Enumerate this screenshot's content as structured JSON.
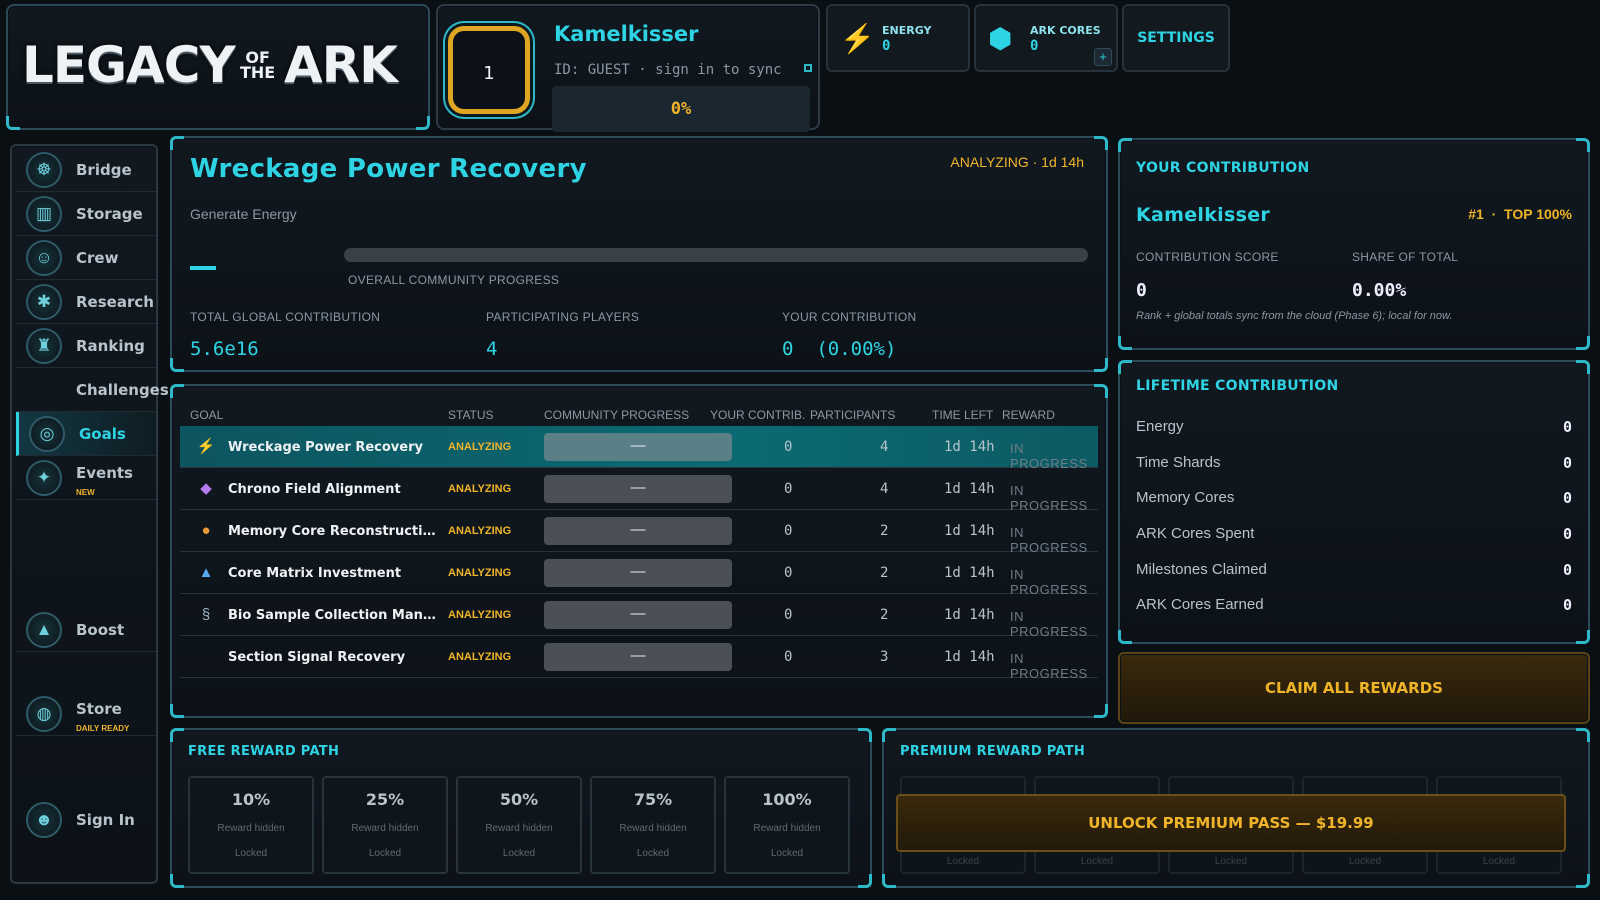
{
  "header": {
    "logo_main": "LEGACY",
    "logo_of": "OF",
    "logo_the": "THE",
    "logo_end": "ARK",
    "level": "1",
    "player_name": "Kamelkisser",
    "player_id": "ID: GUEST · sign in to sync",
    "progress_text": "0%",
    "energy_label": "ENERGY",
    "energy_value": "0",
    "cores_label": "ARK CORES",
    "cores_value": "0",
    "cores_add": "+",
    "settings_label": "SETTINGS"
  },
  "sidebar": {
    "items": [
      {
        "label": "Bridge",
        "icon": "helm-icon"
      },
      {
        "label": "Storage",
        "icon": "crate-icon"
      },
      {
        "label": "Crew",
        "icon": "crew-icon"
      },
      {
        "label": "Research",
        "icon": "atom-icon"
      },
      {
        "label": "Ranking",
        "icon": "podium-icon"
      },
      {
        "label": "Challenges",
        "icon": ""
      },
      {
        "label": "Goals",
        "icon": "target-icon",
        "active": true
      },
      {
        "label": "Events",
        "badge": "NEW",
        "icon": "compass-icon"
      },
      {
        "label": "Boost",
        "icon": "rocket-icon"
      },
      {
        "label": "Store",
        "badge": "DAILY READY",
        "icon": "bag-icon"
      },
      {
        "label": "Sign In",
        "icon": "user-icon"
      }
    ]
  },
  "goal": {
    "title": "Wreckage Power Recovery",
    "subtitle": "Generate Energy",
    "status": "ANALYZING · 1d 14h",
    "progress_label": "OVERALL COMMUNITY PROGRESS",
    "stats": [
      {
        "label": "TOTAL GLOBAL CONTRIBUTION",
        "value": "5.6e16"
      },
      {
        "label": "PARTICIPATING PLAYERS",
        "value": "4"
      },
      {
        "label": "YOUR CONTRIBUTION",
        "value": "0  (0.00%)"
      }
    ]
  },
  "table": {
    "headers": [
      "GOAL",
      "STATUS",
      "COMMUNITY PROGRESS",
      "YOUR CONTRIB.",
      "PARTICIPANTS",
      "TIME LEFT",
      "REWARD"
    ],
    "rows": [
      {
        "name": "Wreckage Power Recovery",
        "status": "ANALYZING",
        "progress": "—",
        "contrib": "0",
        "participants": "4",
        "time": "1d 14h",
        "reward": "IN PROGRESS",
        "icon": "lightning-icon"
      },
      {
        "name": "Chrono Field Alignment",
        "status": "ANALYZING",
        "progress": "—",
        "contrib": "0",
        "participants": "4",
        "time": "1d 14h",
        "reward": "IN PROGRESS",
        "icon": "crystal-icon"
      },
      {
        "name": "Memory Core Reconstruction",
        "status": "ANALYZING",
        "progress": "—",
        "contrib": "0",
        "participants": "2",
        "time": "1d 14h",
        "reward": "IN PROGRESS",
        "icon": "orb-icon"
      },
      {
        "name": "Core Matrix Investment",
        "status": "ANALYZING",
        "progress": "—",
        "contrib": "0",
        "participants": "2",
        "time": "1d 14h",
        "reward": "IN PROGRESS",
        "icon": "matrix-icon"
      },
      {
        "name": "Bio Sample Collection Mand...",
        "status": "ANALYZING",
        "progress": "—",
        "contrib": "0",
        "participants": "2",
        "time": "1d 14h",
        "reward": "IN PROGRESS",
        "icon": "dna-icon"
      },
      {
        "name": "Section Signal Recovery",
        "status": "ANALYZING",
        "progress": "—",
        "contrib": "0",
        "participants": "3",
        "time": "1d 14h",
        "reward": "IN PROGRESS",
        "icon": ""
      }
    ]
  },
  "contribution": {
    "title": "YOUR CONTRIBUTION",
    "name": "Kamelkisser",
    "rank": "#1  ·  TOP 100%",
    "score_label": "CONTRIBUTION SCORE",
    "score_value": "0",
    "share_label": "SHARE OF TOTAL",
    "share_value": "0.00%",
    "note": "Rank + global totals sync from the cloud (Phase 6); local for now."
  },
  "lifetime": {
    "title": "LIFETIME CONTRIBUTION",
    "rows": [
      {
        "label": "Energy",
        "value": "0"
      },
      {
        "label": "Time Shards",
        "value": "0"
      },
      {
        "label": "Memory Cores",
        "value": "0"
      },
      {
        "label": "ARK Cores Spent",
        "value": "0"
      },
      {
        "label": "Milestones Claimed",
        "value": "0"
      },
      {
        "label": "ARK Cores Earned",
        "value": "0"
      }
    ]
  },
  "claim_label": "CLAIM ALL REWARDS",
  "free_path": {
    "title": "FREE REWARD PATH",
    "tiers": [
      {
        "pct": "10%",
        "hidden": "Reward hidden",
        "state": "Locked"
      },
      {
        "pct": "25%",
        "hidden": "Reward hidden",
        "state": "Locked"
      },
      {
        "pct": "50%",
        "hidden": "Reward hidden",
        "state": "Locked"
      },
      {
        "pct": "75%",
        "hidden": "Reward hidden",
        "state": "Locked"
      },
      {
        "pct": "100%",
        "hidden": "Reward hidden",
        "state": "Locked"
      }
    ]
  },
  "premium_path": {
    "title": "PREMIUM REWARD PATH",
    "unlock_label": "UNLOCK PREMIUM PASS — $19.99",
    "tiers": [
      {
        "state": "Locked"
      },
      {
        "state": "Locked"
      },
      {
        "state": "Locked"
      },
      {
        "state": "Locked"
      },
      {
        "state": "Locked"
      }
    ]
  },
  "colors": {
    "accent": "#2fd4e4",
    "gold": "#f0b429",
    "background": "#0a0f14"
  }
}
